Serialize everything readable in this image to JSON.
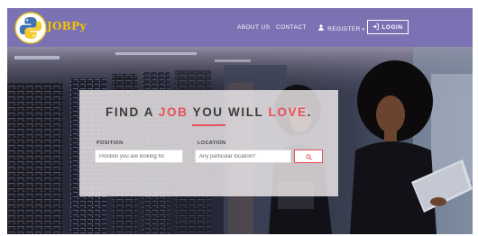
{
  "brand": {
    "name": "JOBPy",
    "logo_icon": "python-logo-icon",
    "name_color": "#f5c400"
  },
  "nav": {
    "background": "#7a72b3",
    "links": [
      {
        "label": "ABOUT US"
      },
      {
        "label": "CONTACT"
      }
    ],
    "register": {
      "label": "REGISTER",
      "icon": "user-icon",
      "caret": "▾"
    },
    "login": {
      "label": "LOGIN",
      "icon": "sign-in-icon"
    }
  },
  "search": {
    "headline": {
      "part1": "FIND A ",
      "part2": "JOB",
      "part3": " YOU WILL ",
      "part4": "LOVE",
      "part5": "."
    },
    "accent": "#e8505b",
    "position": {
      "label": "POSITION",
      "placeholder": "Position you are looking for"
    },
    "location": {
      "label": "LOCATION",
      "placeholder": "Any particular location?"
    },
    "button_icon": "search-icon"
  }
}
